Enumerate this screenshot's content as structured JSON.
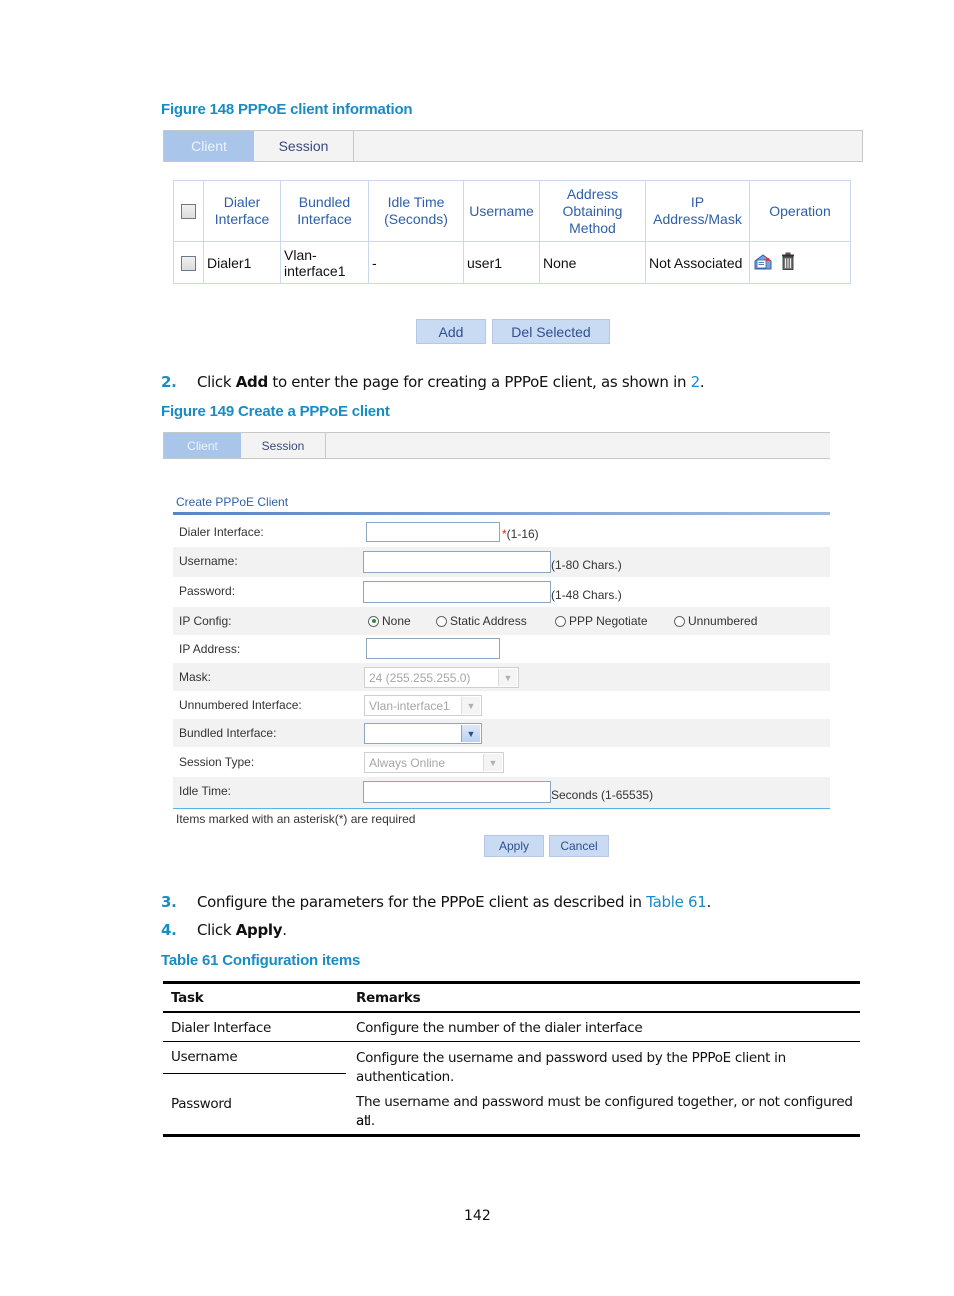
{
  "figure148": {
    "caption": "Figure 148 PPPoE client information",
    "tabs": [
      {
        "label": "Client",
        "active": true
      },
      {
        "label": "Session",
        "active": false
      }
    ],
    "table": {
      "headers": [
        "Dialer Interface",
        "Bundled Interface",
        "Idle Time (Seconds)",
        "Username",
        "Address Obtaining Method",
        "IP Address/Mask",
        "Operation"
      ],
      "header_lines": [
        [
          "Dialer",
          "Interface"
        ],
        [
          "Bundled",
          "Interface"
        ],
        [
          "Idle Time",
          "(Seconds)"
        ],
        [
          "Username"
        ],
        [
          "Address",
          "Obtaining",
          "Method"
        ],
        [
          "IP",
          "Address/Mask"
        ],
        [
          "Operation"
        ]
      ],
      "rows": [
        {
          "dialer_interface": "Dialer1",
          "bundled_interface_lines": [
            "Vlan-",
            "interface1"
          ],
          "idle_time": "-",
          "username": "user1",
          "address_method": "None",
          "ip_mask": "Not Associated",
          "operations": [
            "edit-icon",
            "delete-icon"
          ]
        }
      ]
    },
    "buttons": {
      "add": "Add",
      "del_selected": "Del Selected"
    }
  },
  "step2": {
    "number": "2.",
    "prefix": "Click ",
    "bold": "Add",
    "middle": " to enter the page for creating a PPPoE client, as shown in ",
    "link": "2",
    "suffix": "."
  },
  "figure149": {
    "caption": "Figure 149 Create a PPPoE client",
    "tabs": [
      {
        "label": "Client",
        "active": true
      },
      {
        "label": "Session",
        "active": false
      }
    ],
    "form": {
      "title": "Create PPPoE Client",
      "fields": {
        "dialer_interface": {
          "label": "Dialer Interface:",
          "value": "",
          "required_mark": "*",
          "hint": "(1-16)"
        },
        "username": {
          "label": "Username:",
          "value": "",
          "hint": "(1-80 Chars.)"
        },
        "password": {
          "label": "Password:",
          "value": "",
          "hint": "(1-48 Chars.)"
        },
        "ip_config": {
          "label": "IP Config:",
          "options": [
            "None",
            "Static Address",
            "PPP Negotiate",
            "Unnumbered"
          ],
          "selected": "None"
        },
        "ip_address": {
          "label": "IP Address:",
          "value": ""
        },
        "mask": {
          "label": "Mask:",
          "selected": "24 (255.255.255.0)",
          "disabled": true
        },
        "unnumbered_interface": {
          "label": "Unnumbered Interface:",
          "selected": "Vlan-interface1",
          "disabled": true
        },
        "bundled_interface": {
          "label": "Bundled Interface:",
          "selected": "",
          "disabled": false
        },
        "session_type": {
          "label": "Session Type:",
          "selected": "Always Online",
          "disabled": true
        },
        "idle_time": {
          "label": "Idle Time:",
          "value": "",
          "hint": "Seconds (1-65535)"
        }
      },
      "required_note": "Items marked with an asterisk(*) are required",
      "buttons": {
        "apply": "Apply",
        "cancel": "Cancel"
      }
    }
  },
  "step3": {
    "number": "3.",
    "text": "Configure the parameters for the PPPoE client as described in ",
    "link": "Table 61",
    "suffix": "."
  },
  "step4": {
    "number": "4.",
    "prefix": "Click ",
    "bold": "Apply",
    "suffix": "."
  },
  "table61": {
    "caption": "Table 61 Configuration items",
    "headers": [
      "Task",
      "Remarks"
    ],
    "rows": [
      {
        "task": "Dialer Interface",
        "remarks": "Configure the number of the dialer interface"
      },
      {
        "task": "Username",
        "remarks": "Configure the username and password used by the PPPoE client in authentication."
      },
      {
        "task": "Password",
        "remarks": "The username and password must be configured together, or not configured at all."
      }
    ],
    "merged_remarks_lines": [
      "Configure the username and password used by the PPPoE client in",
      "authentication.",
      "The username and password must be configured together, or not configured at",
      "all."
    ]
  },
  "page_number": "142"
}
